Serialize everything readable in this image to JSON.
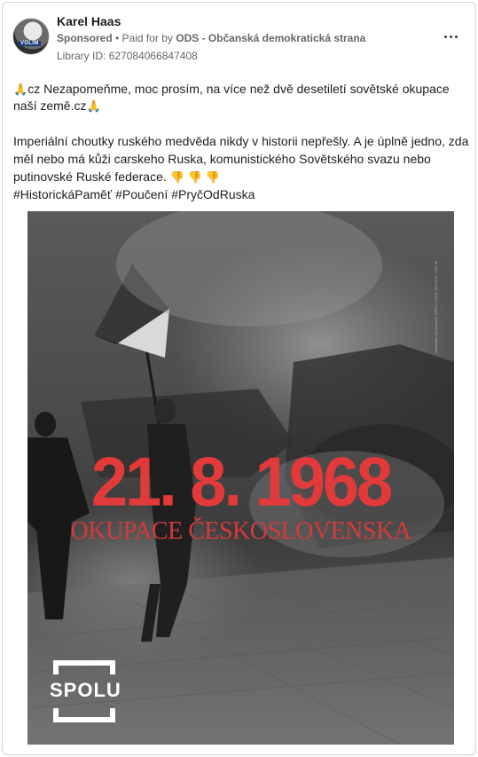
{
  "post": {
    "author": "Karel Haas",
    "sponsored_label": "Sponsored",
    "paid_prefix": " • Paid for by ",
    "paid_by": "ODS - Občanská demokratická strana",
    "library_id": "Library ID: 627084066847408",
    "avatar_tag": "VOLIM"
  },
  "body": {
    "line1": "cz Nezapomeňme, moc prosím, na více než dvě desetiletí sovětské okupace",
    "line2": "naší země.cz",
    "p2_line1": "Imperiální choutky ruského medvěda nikdy v historii nepřešly. A je úplně jedno, zda",
    "p2_line2": "měl nebo má kůži carskeho Ruska, komunistického Sovětského svazu nebo",
    "p2_line3": "putinovské Ruské federace.",
    "hashtags": [
      "#HistorickáPaměť",
      "#Poučení",
      "#PryčOdRuska"
    ]
  },
  "media": {
    "date": "21. 8. 1968",
    "subtitle": "OKUPACE ČESKOSLOVENSKA",
    "side_text": "Zadavatel: Zpracovatel: SPOLU / ODS, KDU-ČSL, TOP 09",
    "logo_text": "SPOLU"
  },
  "icons": {
    "more": "more-horizontal-icon",
    "pray": "folded-hands-emoji",
    "thumbs_down": "thumbs-down-emoji"
  },
  "colors": {
    "accent_red": "#e23a3a",
    "meta_gray": "#65676b"
  }
}
